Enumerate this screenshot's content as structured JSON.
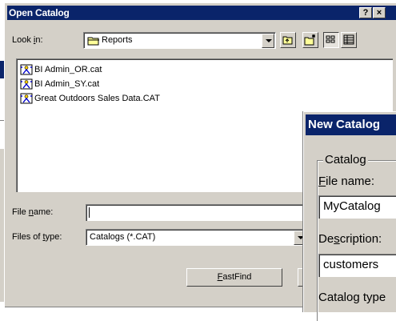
{
  "open_dialog": {
    "title": "Open Catalog",
    "help_button": "?",
    "close_button": "×",
    "look_in_label": "Look in:",
    "look_in_value": "Reports",
    "files": [
      {
        "name": "BI Admin_OR.cat"
      },
      {
        "name": "BI Admin_SY.cat"
      },
      {
        "name": "Great Outdoors Sales Data.CAT"
      }
    ],
    "file_name_label": "File name:",
    "file_name_value": "",
    "files_of_type_label": "Files of type:",
    "files_of_type_value": "Catalogs (*.CAT)",
    "fastfind_label": "FastFind"
  },
  "new_catalog_dialog": {
    "title": "New Catalog",
    "group_label": "Catalog",
    "file_name_label": "File name:",
    "file_name_value": "MyCatalog",
    "description_label": "Description:",
    "description_value": "customers",
    "catalog_type_label": "Catalog type"
  },
  "colors": {
    "title_bar": "#0a246a",
    "face": "#d4d0c8"
  }
}
